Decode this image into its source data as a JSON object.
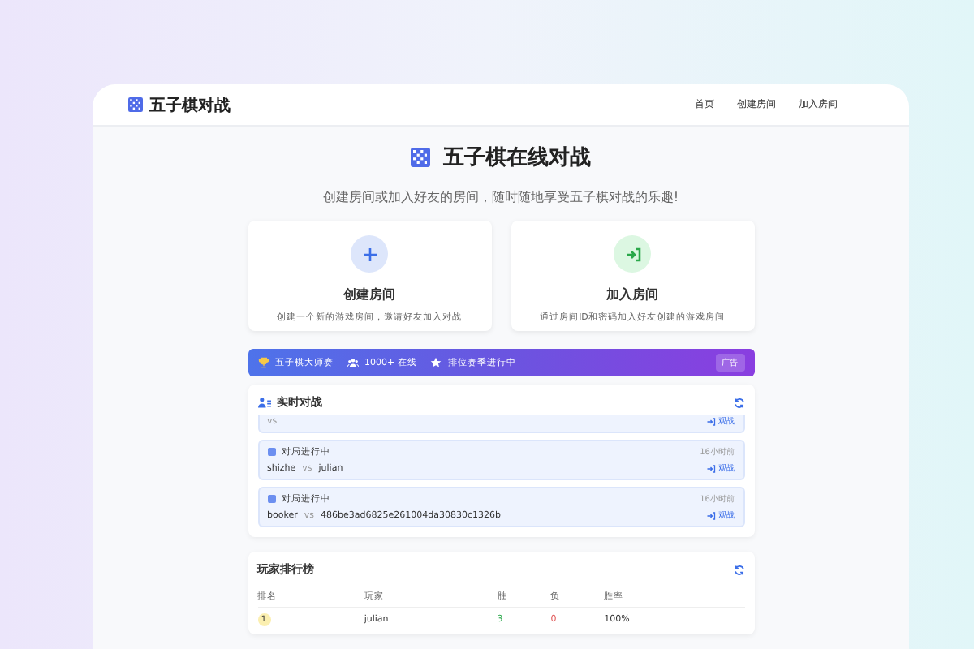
{
  "header": {
    "brand": "五子棋对战",
    "nav": [
      {
        "label": "首页"
      },
      {
        "label": "创建房间"
      },
      {
        "label": "加入房间"
      }
    ]
  },
  "hero": {
    "title": "五子棋在线对战",
    "subtitle": "创建房间或加入好友的房间，随时随地享受五子棋对战的乐趣!"
  },
  "actions": [
    {
      "kind": "create",
      "title": "创建房间",
      "description": "创建一个新的游戏房间，邀请好友加入对战"
    },
    {
      "kind": "join",
      "title": "加入房间",
      "description": "通过房间ID和密码加入好友创建的游戏房间"
    }
  ],
  "banner": {
    "title": "五子棋大师赛",
    "online": "1000+ 在线",
    "season": "排位赛季进行中",
    "badge": "广告"
  },
  "live": {
    "title": "实时对战",
    "matches": [
      {
        "kind": "partial",
        "vs": "vs",
        "watch": "观战"
      },
      {
        "kind": "full",
        "status": "对局进行中",
        "time": "16小时前",
        "player1": "shizhe",
        "vs": "vs",
        "player2": "julian",
        "watch": "观战"
      },
      {
        "kind": "full",
        "status": "对局进行中",
        "time": "16小时前",
        "player1": "booker",
        "vs": "vs",
        "player2": "486be3ad6825e261004da30830c1326b",
        "watch": "观战"
      }
    ]
  },
  "leaderboard": {
    "title": "玩家排行榜",
    "columns": [
      "排名",
      "玩家",
      "胜",
      "负",
      "胜率"
    ],
    "rows": [
      {
        "rank": "1",
        "player": "julian",
        "wins": "3",
        "losses": "0",
        "rate": "100%"
      }
    ]
  }
}
